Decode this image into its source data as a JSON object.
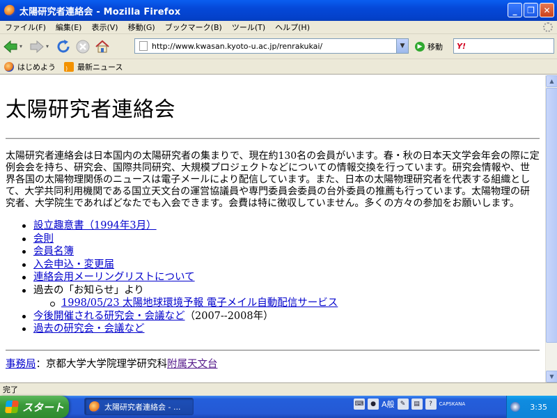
{
  "window": {
    "title": "太陽研究者連絡会 - Mozilla Firefox",
    "buttons": [
      "_",
      "❐",
      "✕"
    ]
  },
  "menubar": {
    "items": [
      "ファイル(F)",
      "編集(E)",
      "表示(V)",
      "移動(G)",
      "ブックマーク(B)",
      "ツール(T)",
      "ヘルプ(H)"
    ]
  },
  "toolbar": {
    "url": "http://www.kwasan.kyoto-u.ac.jp/renrakukai/",
    "go_label": "移動",
    "search_logo": "Y!",
    "icons": [
      "back-icon",
      "forward-icon",
      "reload-icon",
      "stop-icon",
      "home-icon"
    ]
  },
  "bookmarks": {
    "items": [
      {
        "label": "はじめよう",
        "icon": "firefox-icon"
      },
      {
        "label": "最新ニュース",
        "icon": "rss-icon"
      }
    ]
  },
  "page": {
    "title": "太陽研究者連絡会",
    "intro": "太陽研究者連絡会は日本国内の太陽研究者の集まりで、現在約130名の会員がいます。春・秋の日本天文学会年会の際に定例会会を持ち、研究会、国際共同研究、大規模プロジェクトなどについての情報交換を行っています。研究会情報や、世界各国の太陽物理関係のニュースは電子メールにより配信しています。また、日本の太陽物理研究者を代表する組織として、大学共同利用機関である国立天文台の運営協議員や専門委員会委員の台外委員の推薦も行っています。太陽物理の研究者、大学院生であればどなたでも入会できます。会費は特に徴収していません。多くの方々の参加をお願いします。",
    "links": [
      {
        "text": "設立趣意書（1994年3月）"
      },
      {
        "text": "会則"
      },
      {
        "text": "会員名簿"
      },
      {
        "text": "入会申込・変更届"
      },
      {
        "text": "連絡会用メーリングリストについて"
      }
    ],
    "past_notice_label": "過去の「お知らせ」より",
    "past_notice_items": [
      {
        "text": "1998/05/23 太陽地球環境予報 電子メイル自動配信サービス"
      }
    ],
    "upcoming_link": "今後開催される研究会・会議など",
    "upcoming_suffix": "（2007--2008年）",
    "past_link": "過去の研究会・会議など",
    "office_link": "事務局",
    "office_text": "：京都大学大学院理学研究科",
    "office_link2": "附属天文台"
  },
  "statusbar": {
    "text": "完了"
  },
  "taskbar": {
    "start_label": "スタート",
    "task_label": "太陽研究者連絡会 - ...",
    "ime_label": "A般",
    "caps": "CAPS",
    "kana": "KANA",
    "clock": "3:35"
  },
  "colors": {
    "link": "#0000cc",
    "visited": "#551a8b",
    "titlebar": "#0548d8",
    "taskbar": "#245edb",
    "start": "#3a9a3a"
  }
}
